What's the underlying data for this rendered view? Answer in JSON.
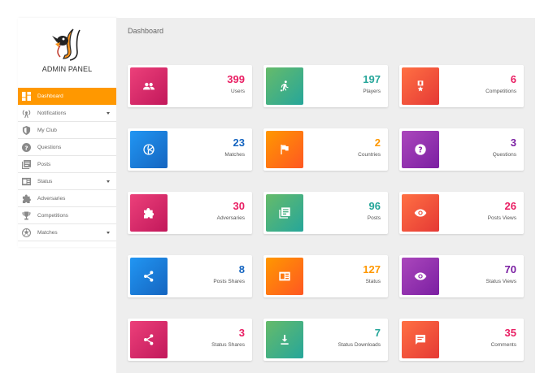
{
  "sidebar": {
    "title": "ADMIN PANEL",
    "items": [
      {
        "label": "Dashboard",
        "icon": "dashboard-icon",
        "active": true,
        "caret": false
      },
      {
        "label": "Notifications",
        "icon": "broadcast-icon",
        "active": false,
        "caret": true
      },
      {
        "label": "My Club",
        "icon": "shield-icon",
        "active": false,
        "caret": false
      },
      {
        "label": "Questions",
        "icon": "help-icon",
        "active": false,
        "caret": false
      },
      {
        "label": "Posts",
        "icon": "posts-icon",
        "active": false,
        "caret": false
      },
      {
        "label": "Status",
        "icon": "status-icon",
        "active": false,
        "caret": true
      },
      {
        "label": "Adversaries",
        "icon": "puzzle-icon",
        "active": false,
        "caret": false
      },
      {
        "label": "Competitions",
        "icon": "trophy-icon",
        "active": false,
        "caret": false
      },
      {
        "label": "Matches",
        "icon": "ball-icon",
        "active": false,
        "caret": true
      }
    ]
  },
  "main": {
    "title": "Dashboard",
    "cards": [
      {
        "value": "399",
        "label": "Users",
        "icon": "users-icon",
        "color": "#e91e63"
      },
      {
        "value": "197",
        "label": "Players",
        "icon": "player-icon",
        "color": "#26a69a"
      },
      {
        "value": "6",
        "label": "Competitions",
        "icon": "medal-icon",
        "color": "#e91e63"
      },
      {
        "value": "23",
        "label": "Matches",
        "icon": "volleyball-icon",
        "color": "#1565c0"
      },
      {
        "value": "2",
        "label": "Countries",
        "icon": "flag-icon",
        "color": "#ff9800"
      },
      {
        "value": "3",
        "label": "Questions",
        "icon": "help-icon",
        "color": "#7b1fa2"
      },
      {
        "value": "30",
        "label": "Adversaries",
        "icon": "puzzle-icon",
        "color": "#e91e63"
      },
      {
        "value": "96",
        "label": "Posts",
        "icon": "posts-icon",
        "color": "#26a69a"
      },
      {
        "value": "26",
        "label": "Posts Views",
        "icon": "eye-icon",
        "color": "#e91e63"
      },
      {
        "value": "8",
        "label": "Posts Shares",
        "icon": "share-icon",
        "color": "#1565c0"
      },
      {
        "value": "127",
        "label": "Status",
        "icon": "status-icon",
        "color": "#ff9800"
      },
      {
        "value": "70",
        "label": "Status Views",
        "icon": "eye-icon",
        "color": "#7b1fa2"
      },
      {
        "value": "3",
        "label": "Status Shares",
        "icon": "share-icon",
        "color": "#e91e63"
      },
      {
        "value": "7",
        "label": "Status Downloads",
        "icon": "download-icon",
        "color": "#26a69a"
      },
      {
        "value": "35",
        "label": "Comments",
        "icon": "comment-icon",
        "color": "#e91e63"
      }
    ]
  }
}
